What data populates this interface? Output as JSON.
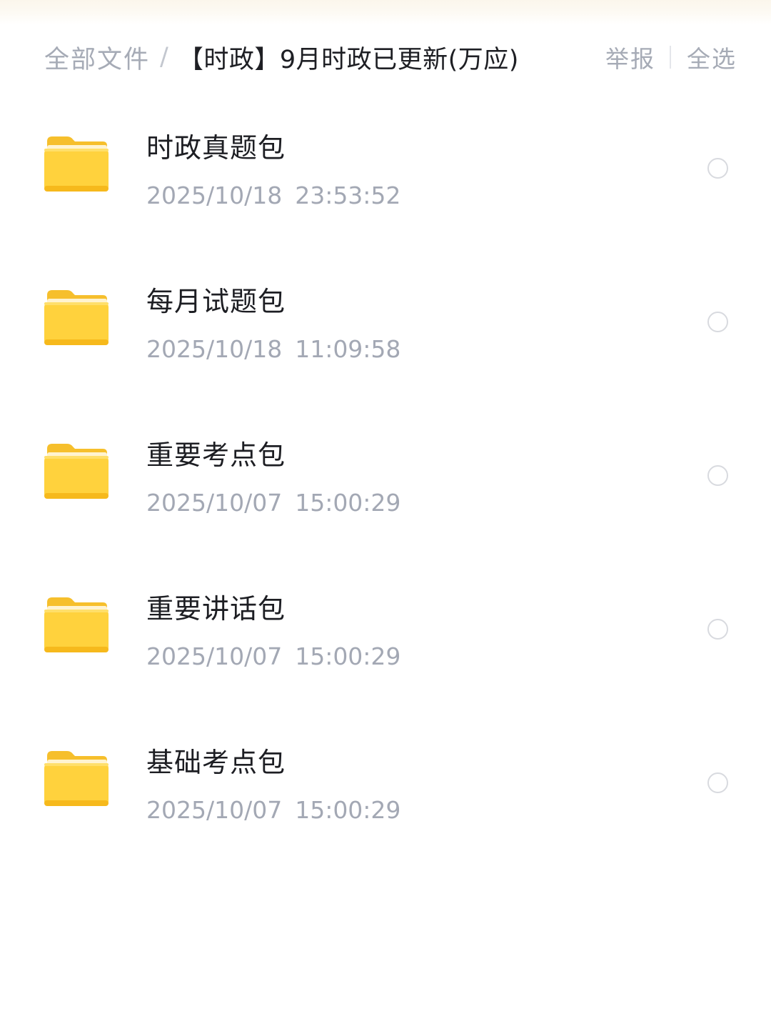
{
  "header": {
    "breadcrumb_root": "全部文件",
    "breadcrumb_separator": "/",
    "breadcrumb_current": "【时政】9月时政已更新(万应)",
    "report_label": "举报",
    "select_all_label": "全选"
  },
  "folders": [
    {
      "name": "时政真题包",
      "date": "2025/10/18",
      "time": "23:53:52",
      "selected": false
    },
    {
      "name": "每月试题包",
      "date": "2025/10/18",
      "time": "11:09:58",
      "selected": false
    },
    {
      "name": "重要考点包",
      "date": "2025/10/07",
      "time": "15:00:29",
      "selected": false
    },
    {
      "name": "重要讲话包",
      "date": "2025/10/07",
      "time": "15:00:29",
      "selected": false
    },
    {
      "name": "基础考点包",
      "date": "2025/10/07",
      "time": "15:00:29",
      "selected": false
    }
  ],
  "colors": {
    "folder_back": "#f7c12f",
    "folder_front": "#ffd23d",
    "text_primary": "#1d1e23",
    "text_secondary": "#a3a8b4",
    "radio_border": "#d8dadf"
  },
  "icons": {
    "folder": "folder-icon",
    "select": "radio-circle-icon"
  }
}
